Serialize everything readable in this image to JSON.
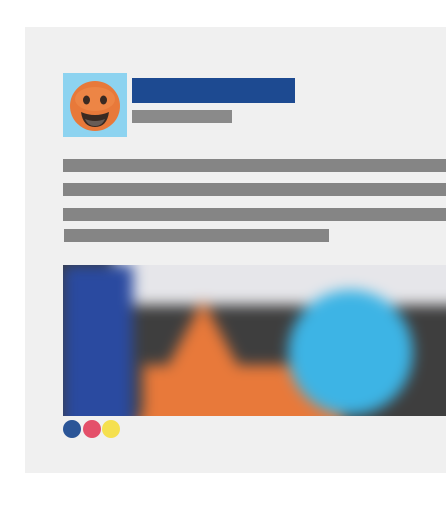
{
  "colors": {
    "avatar_background": "#8dd3f0",
    "avatar_face": "#e8793a",
    "name_bar": "#1d4a91",
    "meta_bar": "#8a8a8a",
    "text_lines": "#858585",
    "card_background": "#f0f0f0"
  },
  "avatar": {
    "icon": "smiley-face-icon"
  },
  "media": {
    "shapes": [
      "blue-rectangle",
      "orange-triangle",
      "blue-circle"
    ],
    "blurred": true
  },
  "reactions": [
    {
      "name": "reaction-dot-blue",
      "color": "#2b5597"
    },
    {
      "name": "reaction-dot-red",
      "color": "#e4506a"
    },
    {
      "name": "reaction-dot-yellow",
      "color": "#f5e04f"
    }
  ]
}
